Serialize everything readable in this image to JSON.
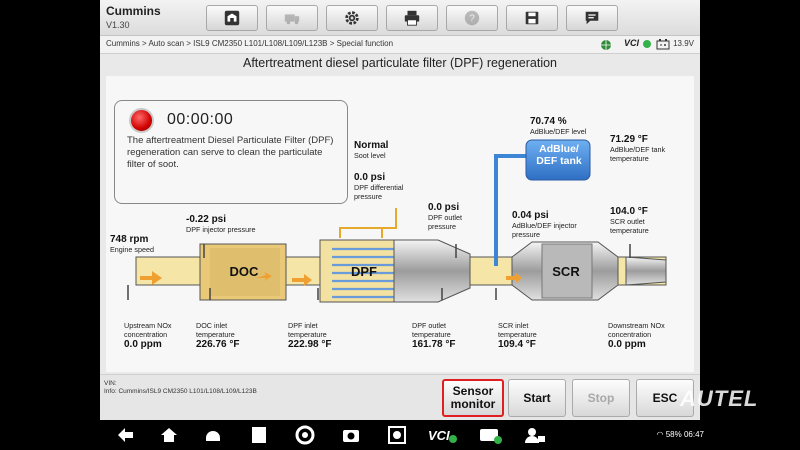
{
  "app": {
    "title": "Cummins",
    "version": "V1.30"
  },
  "toolbar": {
    "buttons": [
      {
        "name": "home",
        "icon": "home-icon",
        "enabled": true
      },
      {
        "name": "vehicle",
        "icon": "vehicle-icon",
        "enabled": false
      },
      {
        "name": "settings",
        "icon": "gear-icon",
        "enabled": true
      },
      {
        "name": "print",
        "icon": "printer-icon",
        "enabled": true
      },
      {
        "name": "help",
        "icon": "help-icon",
        "enabled": false
      },
      {
        "name": "save",
        "icon": "save-icon",
        "enabled": true
      },
      {
        "name": "message",
        "icon": "message-icon",
        "enabled": true
      }
    ]
  },
  "breadcrumb": "Cummins > Auto scan > ISL9 CM2350 L101/L108/L109/L123B > Special function",
  "status": {
    "vci": "VCI",
    "voltage": "13.9V"
  },
  "page_title": "Aftertreatment diesel particulate filter (DPF) regeneration",
  "timer": {
    "value": "00:00:00",
    "description": "The aftertreatment Diesel Particulate Filter (DPF) regeneration can serve to clean the particulate filter of soot."
  },
  "diagram": {
    "engine_speed": {
      "value": "748 rpm",
      "label": "Engine speed"
    },
    "dpf_injector_pressure": {
      "value": "-0.22 psi",
      "label": "DPF injector pressure"
    },
    "soot_level": {
      "value": "Normal",
      "label": "Soot level"
    },
    "dpf_diff_pressure": {
      "value": "0.0 psi",
      "label": "DPF differential pressure"
    },
    "dpf_outlet_pressure": {
      "value": "0.0 psi",
      "label": "DPF outlet pressure"
    },
    "adblue_level": {
      "value": "70.74 %",
      "label": "AdBlue/DEF level"
    },
    "adblue_temp": {
      "value": "71.29 °F",
      "label": "AdBlue/DEF tank temperature"
    },
    "adblue_injector_pressure": {
      "value": "0.04 psi",
      "label": "AdBlue/DEF injector pressure"
    },
    "scr_outlet_temp": {
      "value": "104.0 °F",
      "label": "SCR outlet temperature"
    },
    "upstream_nox": {
      "value": "0.0 ppm",
      "label": "Upstream NOx concentration"
    },
    "doc_inlet_temp": {
      "value": "226.76 °F",
      "label": "DOC inlet temperature"
    },
    "dpf_inlet_temp": {
      "value": "222.98 °F",
      "label": "DPF inlet temperature"
    },
    "dpf_outlet_temp": {
      "value": "161.78 °F",
      "label": "DPF outlet temperature"
    },
    "scr_inlet_temp": {
      "value": "109.4 °F",
      "label": "SCR inlet temperature"
    },
    "downstream_nox": {
      "value": "0.0 ppm",
      "label": "Downstream NOx concentration"
    },
    "components": {
      "doc": "DOC",
      "dpf": "DPF",
      "scr": "SCR",
      "tank": "AdBlue/ DEF tank"
    }
  },
  "footer": {
    "vin_label": "VIN:",
    "info": "Info: Cummins/ISL9 CM2350 L101/L108/L109/L123B",
    "sensor_monitor": "Sensor monitor",
    "start": "Start",
    "stop": "Stop",
    "esc": "ESC"
  },
  "android": {
    "battery": "58%",
    "time": "06:47"
  },
  "brand": "AUTEL",
  "colors": {
    "pipe": "#f5e6a8",
    "accent_red": "#e02020",
    "tank_blue": "#3d86d6"
  }
}
